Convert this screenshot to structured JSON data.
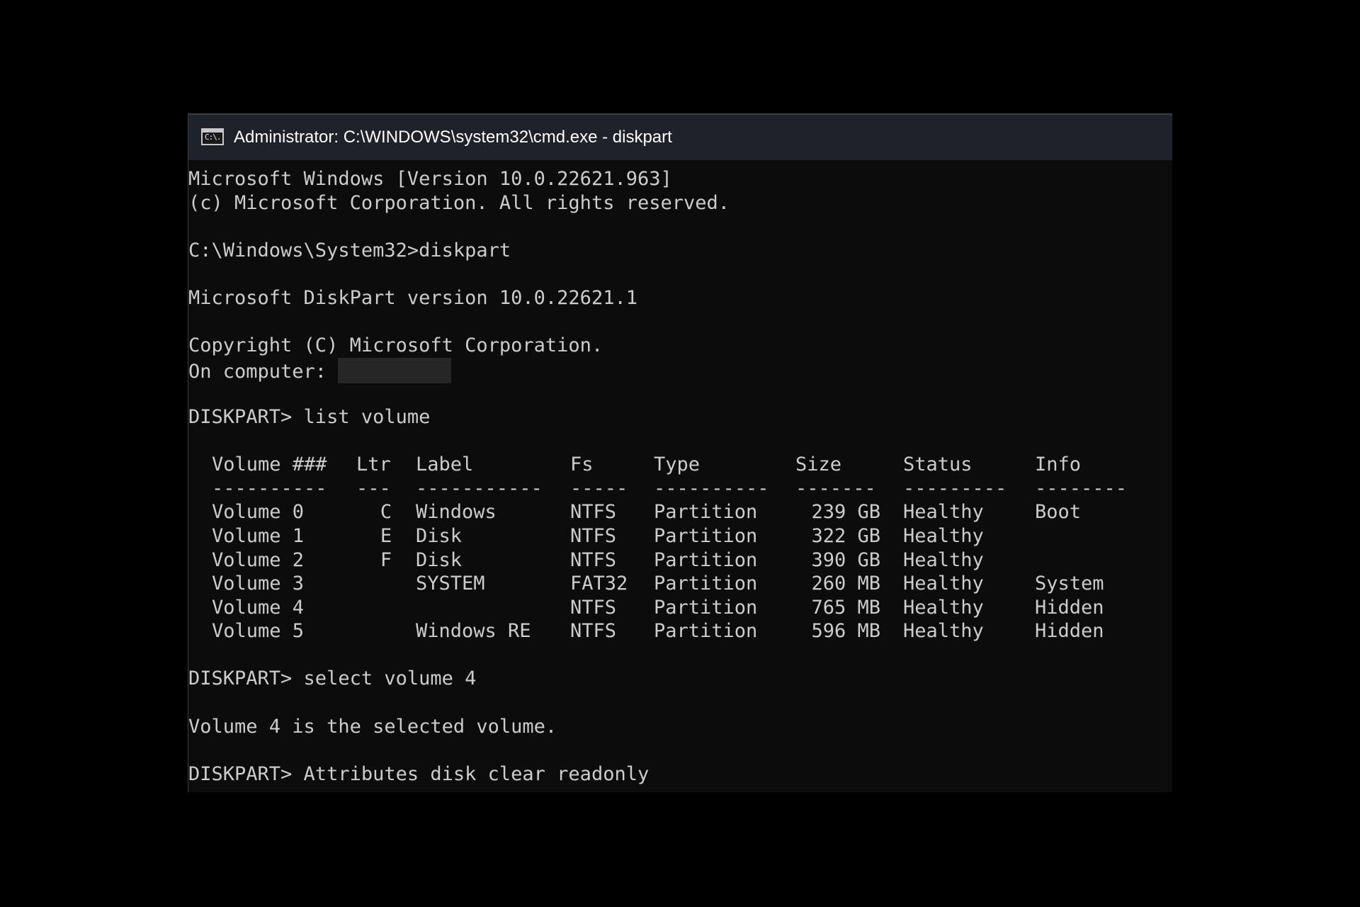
{
  "window": {
    "title": "Administrator: C:\\WINDOWS\\system32\\cmd.exe - diskpart",
    "icon": "cmd-icon",
    "icon_text": "C:\\."
  },
  "console": {
    "lines_top": [
      "Microsoft Windows [Version 10.0.22621.963]",
      "(c) Microsoft Corporation. All rights reserved.",
      "",
      "C:\\Windows\\System32>diskpart",
      "",
      "Microsoft DiskPart version 10.0.22621.1",
      "",
      "Copyright (C) Microsoft Corporation."
    ],
    "computer_prefix": "On computer: ",
    "after_computer": [
      "",
      "DISKPART> list volume",
      ""
    ],
    "table": {
      "headers": [
        "Volume ###",
        "Ltr",
        "Label",
        "Fs",
        "Type",
        "Size",
        "Status",
        "Info"
      ],
      "dashes": [
        "----------",
        "---",
        "-----------",
        "-----",
        "----------",
        "-------",
        "---------",
        "--------"
      ],
      "rows": [
        [
          "Volume 0",
          "C",
          "Windows",
          "NTFS",
          "Partition",
          "239 GB",
          "Healthy",
          "Boot"
        ],
        [
          "Volume 1",
          "E",
          "Disk",
          "NTFS",
          "Partition",
          "322 GB",
          "Healthy",
          ""
        ],
        [
          "Volume 2",
          "F",
          "Disk",
          "NTFS",
          "Partition",
          "390 GB",
          "Healthy",
          ""
        ],
        [
          "Volume 3",
          "",
          "SYSTEM",
          "FAT32",
          "Partition",
          "260 MB",
          "Healthy",
          "System"
        ],
        [
          "Volume 4",
          "",
          "",
          "NTFS",
          "Partition",
          "765 MB",
          "Healthy",
          "Hidden"
        ],
        [
          "Volume 5",
          "",
          "Windows RE",
          "NTFS",
          "Partition",
          "596 MB",
          "Healthy",
          "Hidden"
        ]
      ]
    },
    "lines_bottom": [
      "",
      "DISKPART> select volume 4",
      "",
      "Volume 4 is the selected volume.",
      "",
      "DISKPART> Attributes disk clear readonly"
    ]
  }
}
